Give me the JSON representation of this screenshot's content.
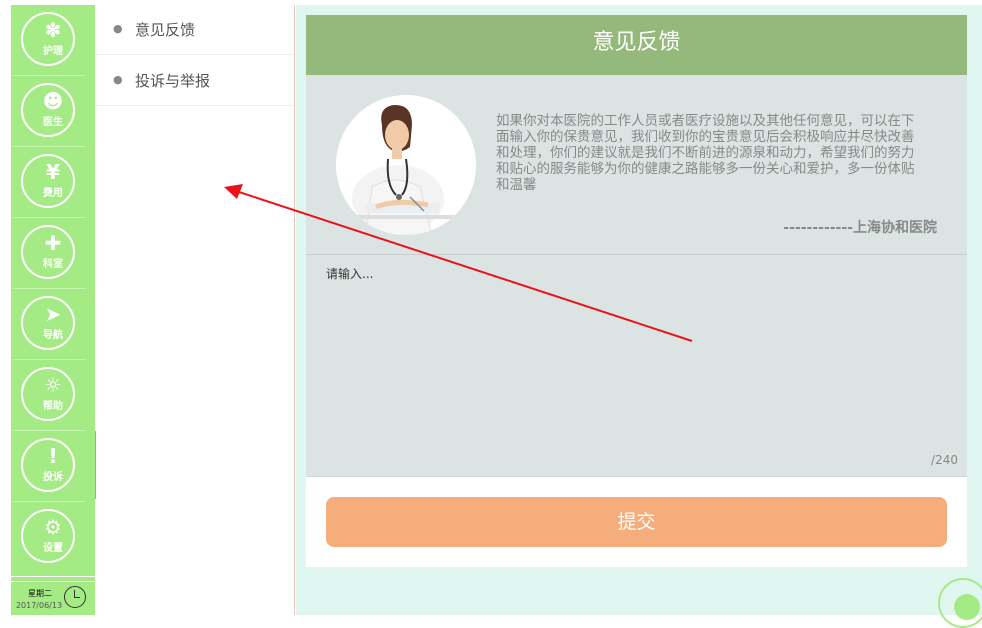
{
  "rail": {
    "items": [
      {
        "label": "护理",
        "icon": "nursing-icon",
        "glyph": "✽"
      },
      {
        "label": "医生",
        "icon": "doctor-icon",
        "glyph": "☻"
      },
      {
        "label": "费用",
        "icon": "fee-icon",
        "glyph": "¥"
      },
      {
        "label": "科室",
        "icon": "department-icon",
        "glyph": "✚"
      },
      {
        "label": "导航",
        "icon": "navigation-icon",
        "glyph": "➤"
      },
      {
        "label": "帮助",
        "icon": "help-icon",
        "glyph": "☼"
      },
      {
        "label": "投诉",
        "icon": "complaint-icon",
        "glyph": "!"
      },
      {
        "label": "设置",
        "icon": "settings-icon",
        "glyph": "⚙"
      }
    ],
    "active_item": "投诉",
    "weekday": "星期二",
    "date": "2017/06/13"
  },
  "submenu": {
    "items": [
      {
        "label": "意见反馈"
      },
      {
        "label": "投诉与举报"
      }
    ]
  },
  "feedback": {
    "title": "意见反馈",
    "intro": "如果你对本医院的工作人员或者医疗设施以及其他任何意见，可以在下面输入你的保贵意见，我们收到你的宝贵意见后会积极响应并尽快改善和处理，你们的建议就是我们不断前进的源泉和动力，希望我们的努力和贴心的服务能够为你的健康之路能够多一份关心和爱护，多一份体贴和温馨",
    "signature": "------------上海协和医院",
    "input_placeholder": "请输入...",
    "counter": "/240",
    "submit_label": "提交"
  },
  "colors": {
    "rail_green": "#a4eb85",
    "header_green": "#95b87b",
    "submit_orange": "#f6ad7c",
    "background_mint": "#dff6f1",
    "annotation_arrow": "#e8141c"
  }
}
